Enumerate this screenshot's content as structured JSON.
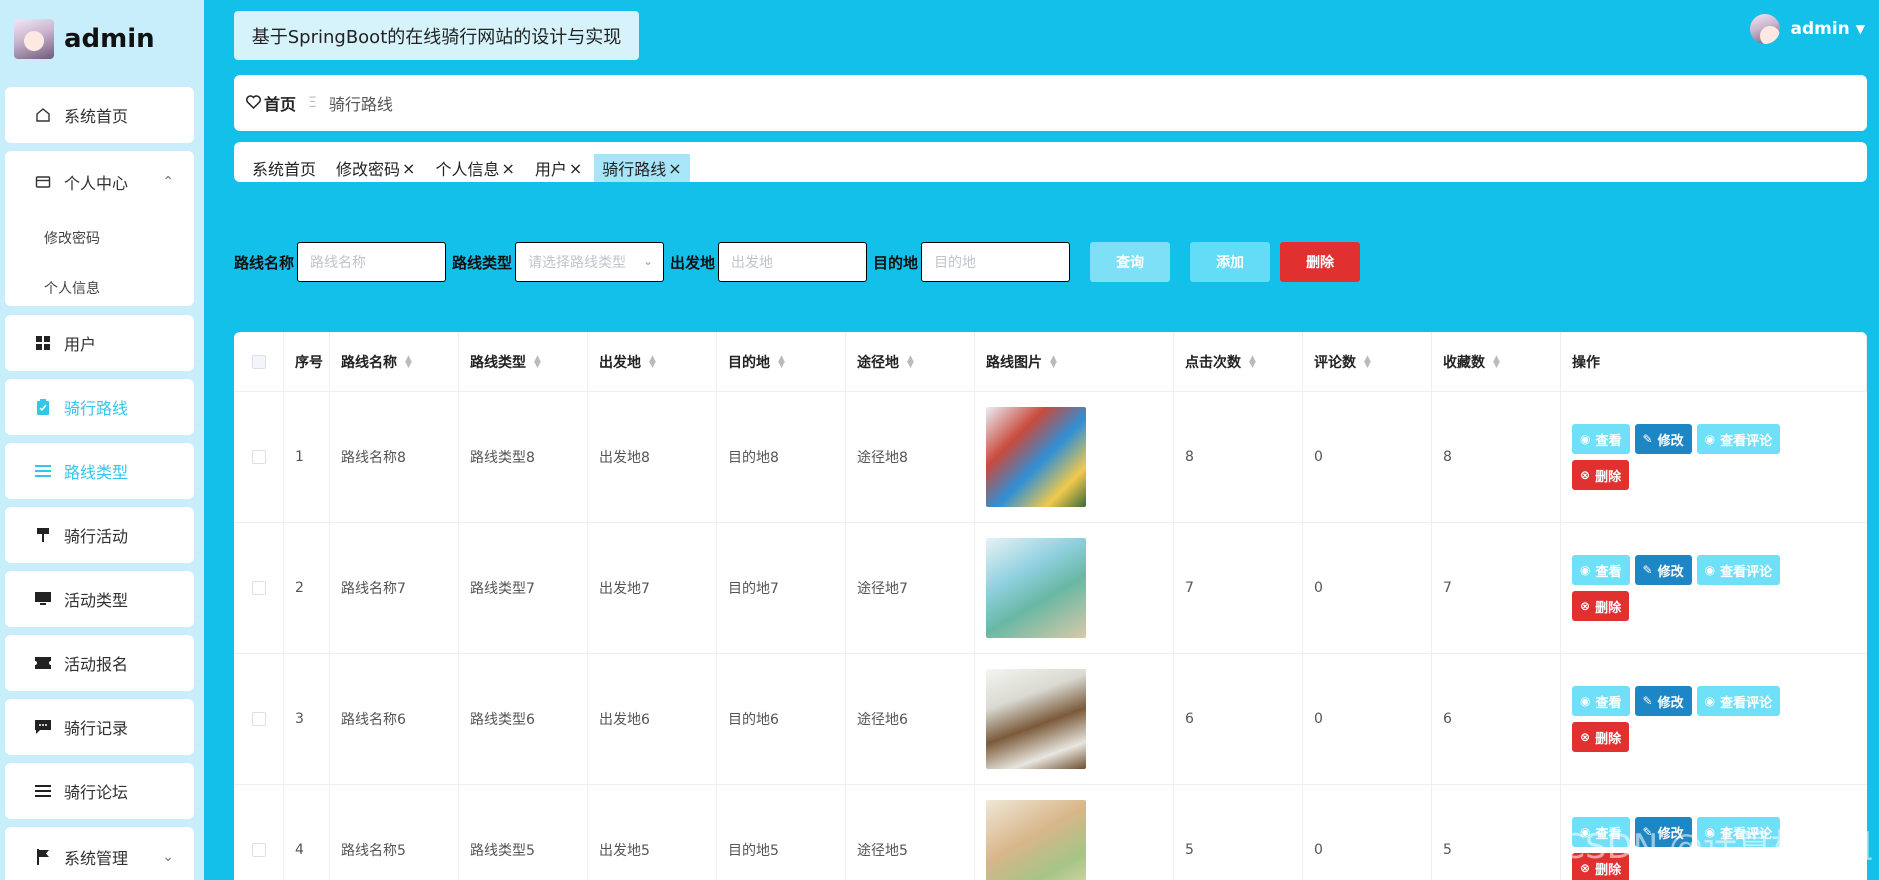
{
  "brand": {
    "name": "admin"
  },
  "sidebar": {
    "items": [
      {
        "label": "系统首页",
        "icon": "home-icon"
      },
      {
        "label": "个人中心",
        "icon": "card-icon",
        "sub": [
          "修改密码",
          "个人信息"
        ]
      },
      {
        "label": "用户",
        "icon": "grid-icon"
      },
      {
        "label": "骑行路线",
        "icon": "clipboard-icon",
        "active": true
      },
      {
        "label": "路线类型",
        "icon": "list-icon",
        "active": true
      },
      {
        "label": "骑行活动",
        "icon": "flag-stand-icon"
      },
      {
        "label": "活动类型",
        "icon": "monitor-icon"
      },
      {
        "label": "活动报名",
        "icon": "ticket-icon"
      },
      {
        "label": "骑行记录",
        "icon": "chat-icon"
      },
      {
        "label": "骑行论坛",
        "icon": "lines-icon"
      },
      {
        "label": "系统管理",
        "icon": "flag-icon"
      }
    ]
  },
  "header": {
    "title": "基于SpringBoot的在线骑行网站的设计与实现",
    "user": "admin"
  },
  "breadcrumb": {
    "home": "首页",
    "sep": "Ξ",
    "current": "骑行路线"
  },
  "tags": [
    {
      "label": "系统首页",
      "closable": false
    },
    {
      "label": "修改密码",
      "closable": true
    },
    {
      "label": "个人信息",
      "closable": true
    },
    {
      "label": "用户",
      "closable": true
    },
    {
      "label": "骑行路线",
      "closable": true,
      "active": true
    }
  ],
  "search": {
    "route_name_label": "路线名称",
    "route_name_placeholder": "路线名称",
    "route_type_label": "路线类型",
    "route_type_placeholder": "请选择路线类型",
    "origin_label": "出发地",
    "origin_placeholder": "出发地",
    "dest_label": "目的地",
    "dest_placeholder": "目的地",
    "query": "查询",
    "add": "添加",
    "delete": "删除"
  },
  "table": {
    "columns": [
      "序号",
      "路线名称",
      "路线类型",
      "出发地",
      "目的地",
      "途径地",
      "路线图片",
      "点击次数",
      "评论数",
      "收藏数",
      "操作"
    ],
    "rows": [
      {
        "no": "1",
        "name": "路线名称8",
        "type": "路线类型8",
        "from": "出发地8",
        "to": "目的地8",
        "via": "途径地8",
        "clicks": "8",
        "comments": "0",
        "favs": "8"
      },
      {
        "no": "2",
        "name": "路线名称7",
        "type": "路线类型7",
        "from": "出发地7",
        "to": "目的地7",
        "via": "途径地7",
        "clicks": "7",
        "comments": "0",
        "favs": "7"
      },
      {
        "no": "3",
        "name": "路线名称6",
        "type": "路线类型6",
        "from": "出发地6",
        "to": "目的地6",
        "via": "途径地6",
        "clicks": "6",
        "comments": "0",
        "favs": "6"
      },
      {
        "no": "4",
        "name": "路线名称5",
        "type": "路线类型5",
        "from": "出发地5",
        "to": "目的地5",
        "via": "途径地5",
        "clicks": "5",
        "comments": "0",
        "favs": "5"
      }
    ],
    "actions": {
      "view": "查看",
      "edit": "修改",
      "comments": "查看评论",
      "delete": "删除"
    }
  },
  "watermark": "CSDN @计算机学姐"
}
